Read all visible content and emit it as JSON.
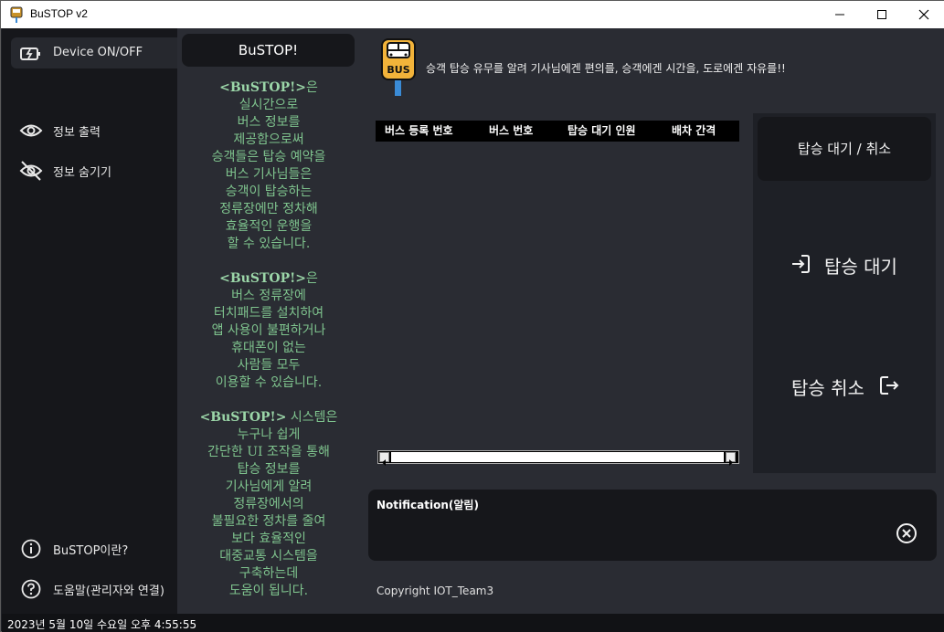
{
  "window": {
    "title": "BuSTOP v2"
  },
  "sidebar": {
    "items": [
      {
        "label": "Device ON/OFF",
        "icon": "power-plug-icon"
      },
      {
        "label": "정보 출력",
        "icon": "eye-icon"
      },
      {
        "label": "정보 숨기기",
        "icon": "eye-off-icon"
      },
      {
        "label": "BuSTOP이란?",
        "icon": "info-icon"
      },
      {
        "label": "도움말(관리자와 연결)",
        "icon": "help-icon"
      }
    ]
  },
  "description": {
    "title": "BuSTOP!",
    "paragraphs": [
      {
        "brand": "<BuSTOP!>",
        "text": "은\n실시간으로\n버스 정보를\n제공함으로써\n승객들은 탑승 예약을\n버스 기사님들은\n승객이 탑승하는\n정류장에만 정차해\n효율적인 운행을\n할 수 있습니다."
      },
      {
        "brand": "<BuSTOP!>",
        "text": "은\n버스 정류장에\n터치패드를 설치하여\n앱 사용이 불편하거나\n휴대폰이 없는\n사람들 모두\n이용할 수 있습니다."
      },
      {
        "brand": "<BuSTOP!>",
        "text": " 시스템은\n누구나 쉽게\n간단한 UI 조작을 통해\n탑승 정보를\n기사님에게 알려\n정류장에서의\n불필요한 정차를 줄여\n보다 효율적인\n대중교통 시스템을\n구축하는데\n도움이 됩니다."
      }
    ]
  },
  "header": {
    "logo_text": "BUS",
    "slogan": "승객 탑승 유무를 알려 기사님에겐 편의를, 승객에겐 시간을, 도로에겐 자유를!!"
  },
  "table": {
    "columns": [
      "버스 등록 번호",
      "버스 번호",
      "탑승 대기 인원",
      "배차 간격"
    ],
    "rows": []
  },
  "boarding": {
    "header": "탑승 대기 / 취소",
    "wait_label": "탑승 대기",
    "cancel_label": "탑승 취소"
  },
  "notification": {
    "title": "Notification(알림)"
  },
  "footer": {
    "copyright": "Copyright IOT_Team3"
  },
  "status": {
    "datetime": "2023년 5월 10일 수요일 오후 4:55:55"
  },
  "colors": {
    "accent_green": "#7fc48e",
    "bus_logo": "#f2b33a",
    "panel_dark": "#16171b",
    "panel_mid": "#2a2c33"
  }
}
